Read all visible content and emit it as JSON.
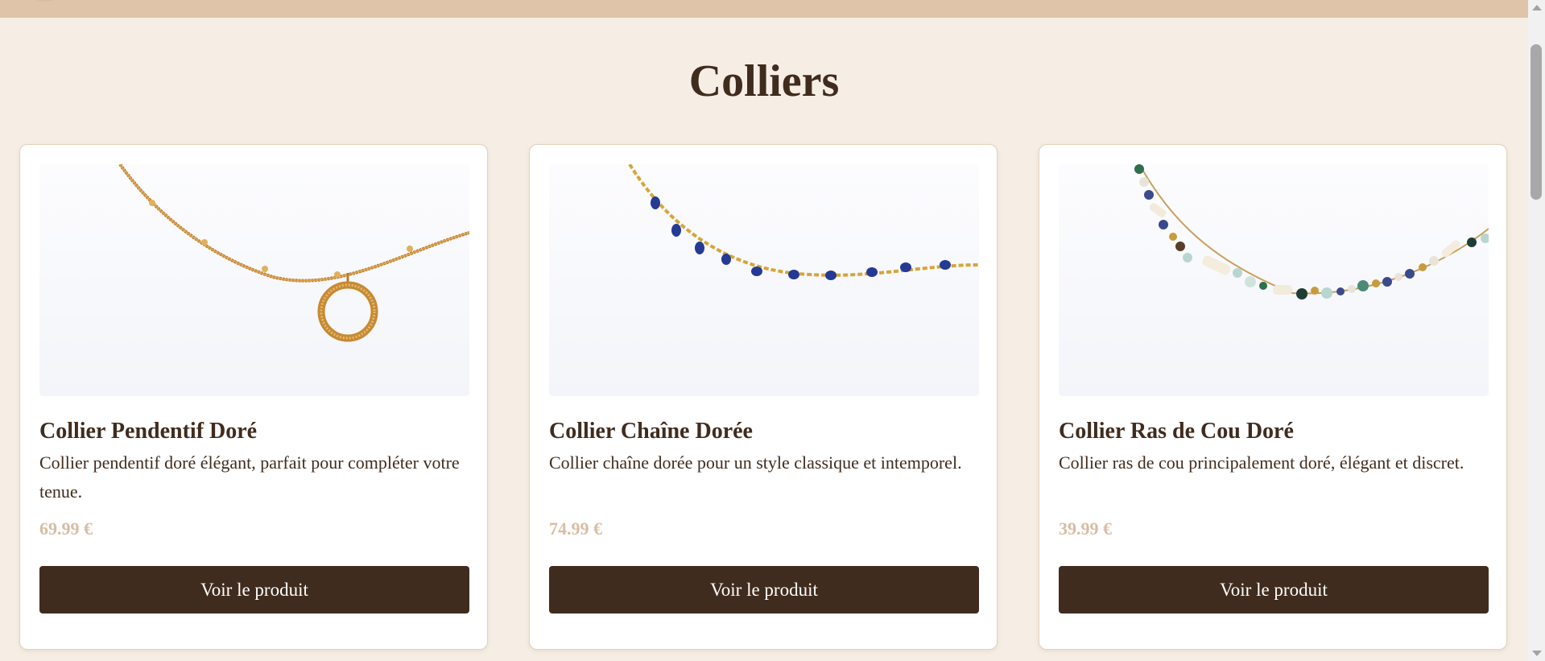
{
  "section": {
    "title": "Colliers"
  },
  "products": [
    {
      "name": "Collier Pendentif Doré",
      "description": "Collier pendentif doré élégant, parfait pour compléter votre tenue.",
      "price": "69.99 €",
      "button_label": "Voir le produit",
      "image_icon": "gold-pendant-necklace-image"
    },
    {
      "name": "Collier Chaîne Dorée",
      "description": "Collier chaîne dorée pour un style classique et intemporel.",
      "price": "74.99 €",
      "button_label": "Voir le produit",
      "image_icon": "gold-chain-blue-beads-necklace-image"
    },
    {
      "name": "Collier Ras de Cou Doré",
      "description": "Collier ras de cou principalement doré, élégant et discret.",
      "price": "39.99 €",
      "button_label": "Voir le produit",
      "image_icon": "beaded-choker-necklace-image"
    }
  ],
  "colors": {
    "background": "#f6eee5",
    "top_bar": "#dfc4aa",
    "text_dark": "#402c1e",
    "price": "#d8bda2",
    "button": "#402c1e",
    "button_text": "#ffffff"
  }
}
